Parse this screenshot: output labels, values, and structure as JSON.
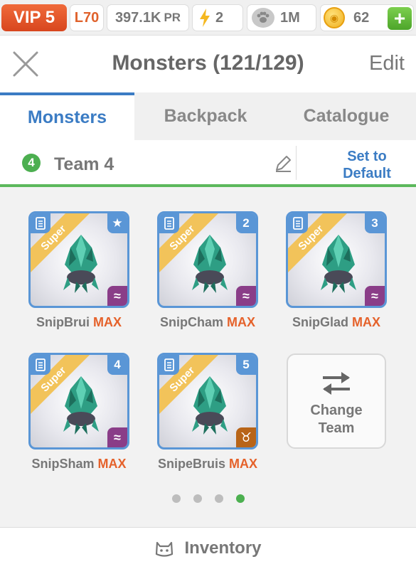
{
  "statusbar": {
    "vip": "VIP 5",
    "level": "L70",
    "power": "397.1K",
    "power_unit": "PR",
    "energy": "2",
    "food": "1M",
    "coins": "62",
    "add_label": "+"
  },
  "header": {
    "title": "Monsters (121/129)",
    "edit_label": "Edit"
  },
  "tabs": [
    {
      "label": "Monsters",
      "active": true
    },
    {
      "label": "Backpack",
      "active": false
    },
    {
      "label": "Catalogue",
      "active": false
    }
  ],
  "team": {
    "number": "4",
    "name": "Team 4",
    "default_label_line1": "Set to",
    "default_label_line2": "Default"
  },
  "monsters": [
    {
      "name": "SnipBrui",
      "level": "MAX",
      "rarity": "Super",
      "slot": "★",
      "element": "water"
    },
    {
      "name": "SnipCham",
      "level": "MAX",
      "rarity": "Super",
      "slot": "2",
      "element": "water"
    },
    {
      "name": "SnipGlad",
      "level": "MAX",
      "rarity": "Super",
      "slot": "3",
      "element": "water"
    },
    {
      "name": "SnipSham",
      "level": "MAX",
      "rarity": "Super",
      "slot": "4",
      "element": "water"
    },
    {
      "name": "SnipeBruis",
      "level": "MAX",
      "rarity": "Super",
      "slot": "5",
      "element": "earth"
    }
  ],
  "element_glyphs": {
    "water": "≈",
    "earth": "♉"
  },
  "change_team": {
    "line1": "Change",
    "line2": "Team"
  },
  "pagination": {
    "pages": 4,
    "current": 4
  },
  "footer": {
    "label": "Inventory"
  },
  "colors": {
    "accent_blue": "#3b7cc4",
    "vip_orange": "#e0582a",
    "max_orange": "#e5622b",
    "green": "#4cb050",
    "water_purple": "#8a3d88",
    "earth_brown": "#b86418"
  }
}
